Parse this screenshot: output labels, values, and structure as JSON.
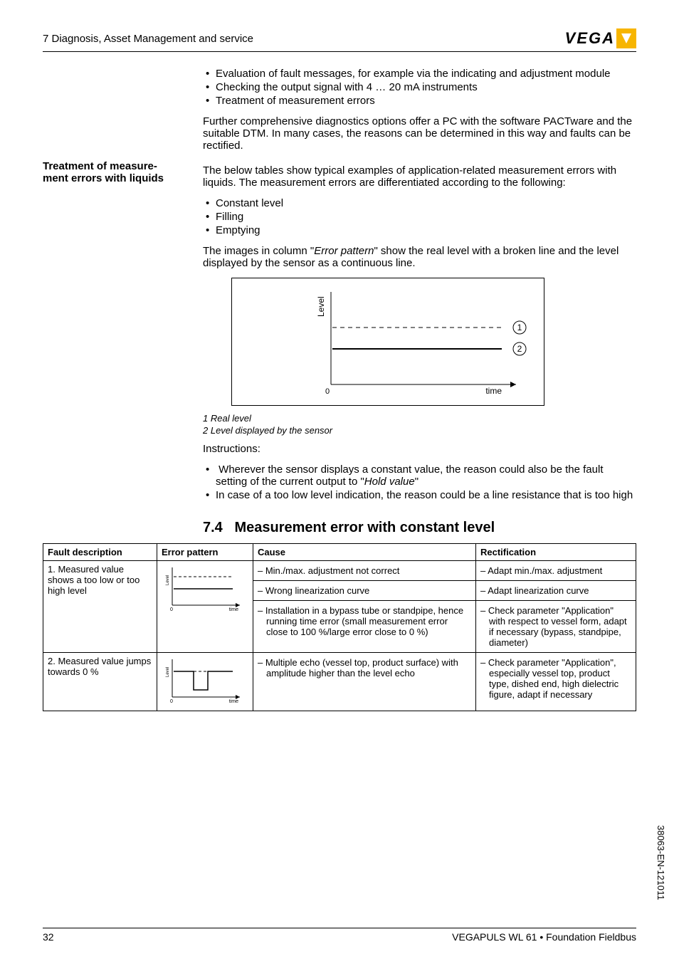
{
  "header": {
    "title": "7 Diagnosis, Asset Management and service"
  },
  "logo": {
    "text": "VEGA"
  },
  "intro_bullets": [
    "Evaluation of fault messages, for example via the indicating and adjustment module",
    "Checking the output signal with 4 … 20 mA instruments",
    "Treatment of measurement errors"
  ],
  "intro_para": "Further comprehensive diagnostics options offer a PC with the software PACTware and the suitable DTM. In many cases, the reasons can be determined in this way and faults can be rectified.",
  "sidehead": {
    "line1": "Treatment of measure-",
    "line2": "ment errors with liquids"
  },
  "treatment_para": "The below tables show typical examples of application-related measurement errors with liquids. The measurement errors are differentiated according to the following:",
  "treatment_bullets": [
    "Constant level",
    "Filling",
    "Emptying"
  ],
  "pattern_para_pre": "The images in column \"",
  "pattern_para_em": "Error pattern",
  "pattern_para_post": "\" show the real level with a broken line and the level displayed by the sensor as a continuous line.",
  "caption": {
    "l1": "1    Real level",
    "l2": "2    Level displayed by the sensor"
  },
  "instructions_label": "Instructions:",
  "instructions_bullets_0_pre": "Wherever the sensor displays a constant value, the reason could also be the fault setting of the current output to \"",
  "instructions_bullets_0_em": "Hold value",
  "instructions_bullets_0_post": "\"",
  "instructions_bullets_1": "In case of a too low level indication, the reason could be a line resistance that is too high",
  "section_num": "7.4",
  "section_title": "Measurement error with constant level",
  "table": {
    "headers": {
      "c1": "Fault description",
      "c2": "Error pattern",
      "c3": "Cause",
      "c4": "Rectification"
    },
    "row1": {
      "desc": "1. Measured value shows a too low or too high level",
      "cause1": "Min./max. adjustment not correct",
      "rect1": "Adapt min./max. adjustment",
      "cause2": "Wrong linearization curve",
      "rect2": "Adapt linearization curve",
      "cause3": "Installation in a bypass tube or standpipe, hence running time error (small measurement error close to 100 %/large error close to 0 %)",
      "rect3": "Check parameter \"Application\" with respect to vessel form, adapt if necessary (bypass, standpipe, diameter)"
    },
    "row2": {
      "desc": "2. Measured value jumps towards 0 %",
      "cause": "Multiple echo (vessel top, product surface) with amplitude higher than the level echo",
      "rect": "Check parameter \"Application\", especially vessel top, product type, dished end, high dielectric figure, adapt if necessary"
    }
  },
  "footer": {
    "page": "32",
    "doc": "VEGAPULS WL 61 • Foundation Fieldbus"
  },
  "side_doc": "38063-EN-121011",
  "chart_data": {
    "type": "line",
    "xlabel": "time",
    "ylabel": "Level",
    "x_origin_label": "0",
    "series": [
      {
        "name": "Real level",
        "label_marker": "1",
        "style": "dashed",
        "x": [
          0,
          1
        ],
        "y": [
          0.65,
          0.65
        ]
      },
      {
        "name": "Level displayed by the sensor",
        "label_marker": "2",
        "style": "solid",
        "x": [
          0,
          1
        ],
        "y": [
          0.45,
          0.45
        ]
      }
    ],
    "xlim": [
      0,
      1
    ],
    "ylim": [
      0,
      1
    ]
  },
  "mini_charts": [
    {
      "type": "line",
      "xlabel": "time",
      "ylabel": "Level",
      "x_origin_label": "0",
      "series": [
        {
          "name": "real",
          "style": "dashed",
          "x": [
            0,
            1
          ],
          "y": [
            0.78,
            0.78
          ]
        },
        {
          "name": "displayed",
          "style": "solid",
          "x": [
            0,
            1
          ],
          "y": [
            0.5,
            0.5
          ]
        }
      ]
    },
    {
      "type": "line",
      "xlabel": "time",
      "ylabel": "Level",
      "x_origin_label": "0",
      "series": [
        {
          "name": "real",
          "style": "dashed",
          "x": [
            0,
            1
          ],
          "y": [
            0.7,
            0.7
          ]
        },
        {
          "name": "displayed",
          "style": "step",
          "x": [
            0,
            0.35,
            0.35,
            0.55,
            0.55,
            1
          ],
          "y": [
            0.7,
            0.7,
            0.25,
            0.25,
            0.7,
            0.7
          ]
        }
      ]
    }
  ]
}
